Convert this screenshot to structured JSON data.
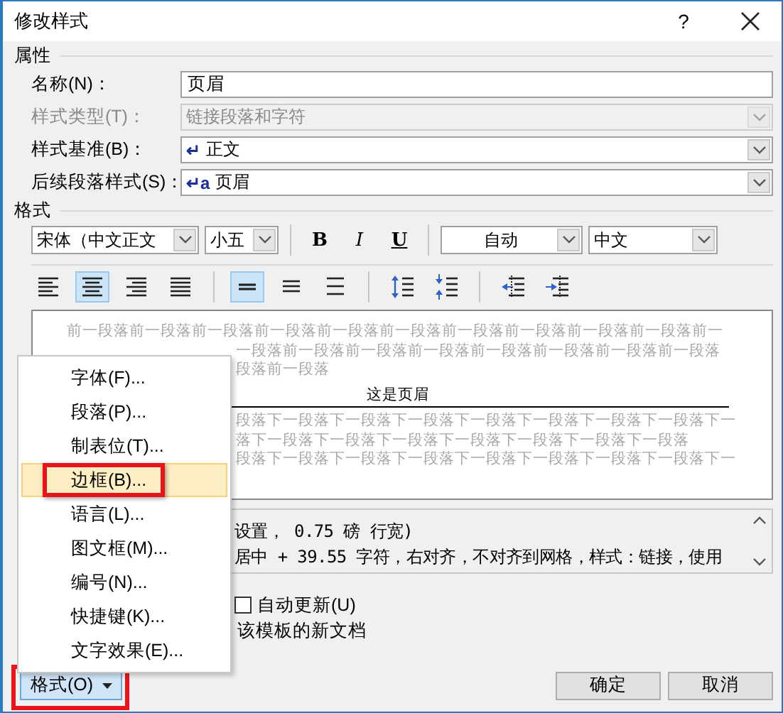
{
  "window": {
    "title": "修改样式",
    "help": "?"
  },
  "properties": {
    "heading": "属性",
    "fields": [
      {
        "label": "名称(N)：",
        "value": "页眉",
        "kind": "text",
        "disabled": false
      },
      {
        "label": "样式类型(T)：",
        "value": "链接段落和字符",
        "kind": "select",
        "disabled": true
      },
      {
        "label": "样式基准(B)：",
        "value": "正文",
        "kind": "select",
        "disabled": false,
        "marker": "↵"
      },
      {
        "label": "后续段落样式(S)：",
        "value": "页眉",
        "kind": "select",
        "disabled": false,
        "marker": "↵a"
      }
    ]
  },
  "format": {
    "heading": "格式",
    "font": "宋体（中文正文",
    "size": "小五",
    "text_buttons": [
      {
        "label": "B",
        "kind": "bold",
        "selected": false
      },
      {
        "label": "I",
        "kind": "italic",
        "selected": false
      },
      {
        "label": "U",
        "kind": "underline",
        "selected": false
      }
    ],
    "font_color": "自动",
    "language": "中文",
    "paragraph_buttons": [
      {
        "kind": "align-left",
        "selected": false
      },
      {
        "kind": "align-center",
        "selected": true
      },
      {
        "kind": "align-right",
        "selected": false
      },
      {
        "kind": "justify",
        "selected": false
      },
      {
        "kind": "spacing-single",
        "selected": true
      },
      {
        "kind": "spacing-one-half",
        "selected": false
      },
      {
        "kind": "spacing-double",
        "selected": false
      },
      {
        "kind": "space-increase",
        "selected": false
      },
      {
        "kind": "space-decrease",
        "selected": false
      },
      {
        "kind": "indent-decrease",
        "selected": false
      },
      {
        "kind": "indent-increase",
        "selected": false
      }
    ]
  },
  "preview": {
    "previous_lines": [
      "前一段落前一段落前一段落前一段落前一段落前一段落前一段落前一段落前一段落前一段落前一",
      "一段落前一段落前一段落前一段落前一段落前一段落前一段落前一段落",
      "段落前一段落"
    ],
    "header_text": "这是页眉",
    "next_lines": [
      "段落下一段落下一段落下一段落下一段落下一段落下一段落下一段落下一",
      "落下一段落下一段落下一段落下一段落下一段落下一段落下一段落",
      "段落下一段落下一段落下一段落下一段落下一段落下一段落下一段落下一"
    ]
  },
  "description": {
    "lines": [
      "设置， 0.75 磅 行宽)",
      "居中 + 39.55 字符，右对齐，不对齐到网格，样式：链接，使用"
    ]
  },
  "options": {
    "auto_update": {
      "label": "自动更新(U)",
      "checked": false
    },
    "note": "该模板的新文档"
  },
  "format_button": {
    "label": "格式(O)",
    "annotated": true
  },
  "buttons": [
    "确定",
    "取消"
  ],
  "menu": {
    "items": [
      {
        "label": "字体(F)...",
        "selected": false,
        "annotated": false
      },
      {
        "label": "段落(P)...",
        "selected": false,
        "annotated": false
      },
      {
        "label": "制表位(T)...",
        "selected": false,
        "annotated": false
      },
      {
        "label": "边框(B)...",
        "selected": true,
        "annotated": true
      },
      {
        "label": "语言(L)...",
        "selected": false,
        "annotated": false
      },
      {
        "label": "图文框(M)...",
        "selected": false,
        "annotated": false
      },
      {
        "label": "编号(N)...",
        "selected": false,
        "annotated": false
      },
      {
        "label": "快捷键(K)...",
        "selected": false,
        "annotated": false
      },
      {
        "label": "文字效果(E)...",
        "selected": false,
        "annotated": false
      }
    ]
  }
}
